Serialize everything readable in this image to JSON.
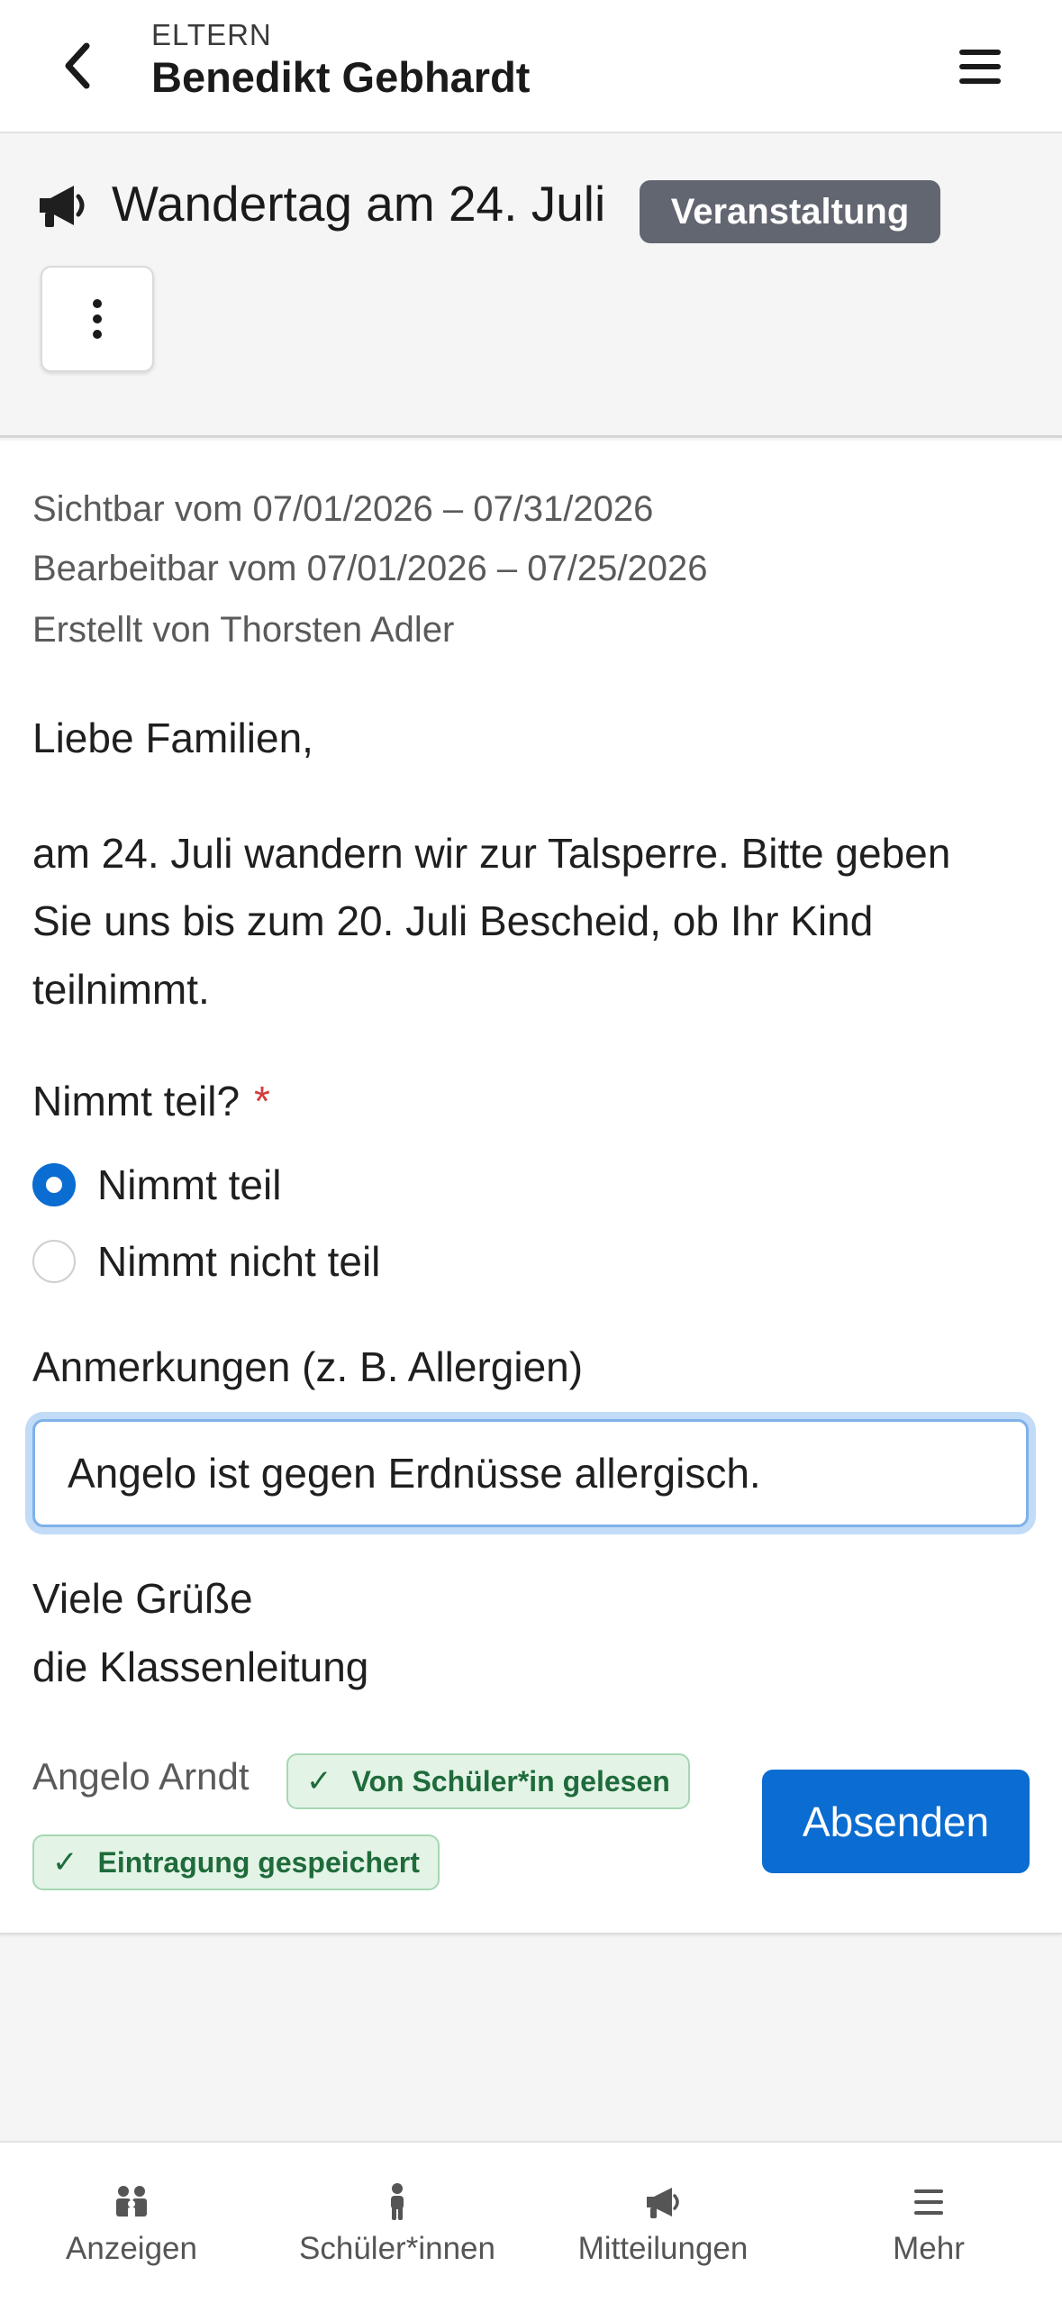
{
  "topbar": {
    "kicker": "ELTERN",
    "title": "Benedikt Gebhardt"
  },
  "post": {
    "title": "Wandertag am 24. Juli",
    "category": "Veranstaltung",
    "visible_range": "Sichtbar vom 07/01/2026 – 07/31/2026",
    "editable_range": "Bearbeitbar vom 07/01/2026 – 07/25/2026",
    "author": "Erstellt von Thorsten Adler",
    "greeting": "Liebe Familien,",
    "body_lines": [
      "am 24. Juli wandern wir zur Talsperre. Bitte geben",
      "Sie uns bis zum 20. Juli Bescheid, ob Ihr Kind",
      "teilnimmt."
    ],
    "closing_lines": [
      "Viele Grüße",
      "die Klassenleitung"
    ]
  },
  "form": {
    "question": "Nimmt teil?",
    "required_mark": "*",
    "options": [
      {
        "label": "Nimmt teil",
        "selected": true
      },
      {
        "label": "Nimmt nicht teil",
        "selected": false
      }
    ],
    "notes_label": "Anmerkungen (z. B. Allergien)",
    "notes_value": "Angelo ist gegen Erdnüsse allergisch."
  },
  "footer": {
    "student": "Angelo Arndt",
    "badge_read": "Von Schüler*in gelesen",
    "badge_saved": "Eintragung gespeichert",
    "submit_label": "Absenden"
  },
  "nav": {
    "items": [
      {
        "label": "Anzeigen",
        "icon": "people-icon"
      },
      {
        "label": "Schüler*innen",
        "icon": "child-icon"
      },
      {
        "label": "Mitteilungen",
        "icon": "megaphone-icon"
      },
      {
        "label": "Mehr",
        "icon": "menu-icon"
      }
    ]
  },
  "colors": {
    "primary": "#0b6cd1",
    "badge_grey": "#616670",
    "success_bg": "#e3f4e7",
    "success_text": "#1f6b3b",
    "required": "#d23b3b"
  }
}
